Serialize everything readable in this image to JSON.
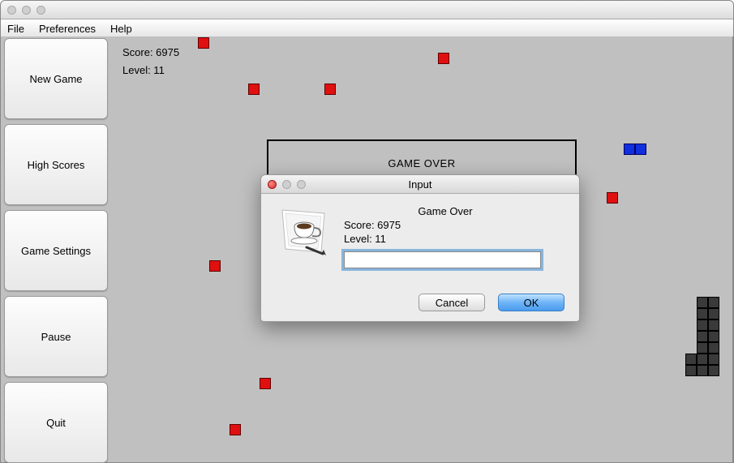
{
  "menubar": {
    "file": "File",
    "preferences": "Preferences",
    "help": "Help"
  },
  "sidebar": {
    "new_game": "New Game",
    "high_scores": "High Scores",
    "game_settings": "Game Settings",
    "pause": "Pause",
    "quit": "Quit"
  },
  "game": {
    "score_label": "Score: 6975",
    "level_label": "Level: 11",
    "gameover_banner": "GAME OVER"
  },
  "dialog": {
    "title": "Input",
    "heading": "Game Over",
    "score_line": "Score:  6975",
    "level_line": "Level:  11",
    "input_value": "",
    "cancel": "Cancel",
    "ok": "OK"
  },
  "colors": {
    "red_block": "#e01010",
    "blue_block": "#1030e0",
    "dark_block": "#3a3a3a",
    "bg": "#c0c0c0"
  }
}
